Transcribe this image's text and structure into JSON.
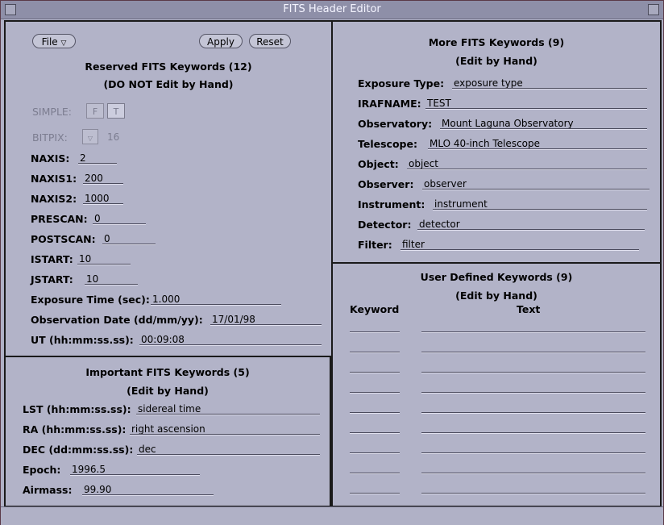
{
  "window": {
    "title": "FITS Header Editor"
  },
  "toolbar": {
    "file_label": "File",
    "apply_label": "Apply",
    "reset_label": "Reset"
  },
  "reserved": {
    "title": "Reserved FITS Keywords (12)",
    "subtitle": "(DO NOT Edit by Hand)",
    "simple_label": "SIMPLE:",
    "simple_options": [
      "F",
      "T"
    ],
    "bitpix_label": "BITPIX:",
    "bitpix_value": "16",
    "fields": [
      {
        "label": "NAXIS:",
        "value": "2"
      },
      {
        "label": "NAXIS1:",
        "value": "200"
      },
      {
        "label": "NAXIS2:",
        "value": "1000"
      },
      {
        "label": "PRESCAN:",
        "value": "0"
      },
      {
        "label": "POSTSCAN:",
        "value": "0"
      },
      {
        "label": "ISTART:",
        "value": "10"
      },
      {
        "label": "JSTART:",
        "value": "10"
      },
      {
        "label": "Exposure Time (sec):",
        "value": "1.000"
      },
      {
        "label": "Observation Date (dd/mm/yy):",
        "value": "17/01/98"
      },
      {
        "label": "UT (hh:mm:ss.ss):",
        "value": "00:09:08"
      }
    ]
  },
  "important": {
    "title": "Important FITS Keywords (5)",
    "subtitle": "(Edit by Hand)",
    "fields": [
      {
        "label": "LST (hh:mm:ss.ss):",
        "value": "sidereal time"
      },
      {
        "label": "RA (hh:mm:ss.ss):",
        "value": "right ascension"
      },
      {
        "label": "DEC (dd:mm:ss.ss):",
        "value": "dec"
      },
      {
        "label": "Epoch:",
        "value": "1996.5"
      },
      {
        "label": "Airmass:",
        "value": "99.90"
      }
    ]
  },
  "more": {
    "title": "More FITS Keywords (9)",
    "subtitle": "(Edit by Hand)",
    "fields": [
      {
        "label": "Exposure Type:",
        "value": "exposure type"
      },
      {
        "label": "IRAFNAME:",
        "value": "TEST"
      },
      {
        "label": "Observatory:",
        "value": "Mount Laguna Observatory"
      },
      {
        "label": "Telescope:",
        "value": "MLO 40-inch Telescope"
      },
      {
        "label": "Object:",
        "value": "object"
      },
      {
        "label": "Observer:",
        "value": "observer"
      },
      {
        "label": "Instrument:",
        "value": "instrument"
      },
      {
        "label": "Detector:",
        "value": "detector"
      },
      {
        "label": "Filter:",
        "value": "filter"
      }
    ]
  },
  "user": {
    "title": "User Defined Keywords (9)",
    "subtitle": "(Edit by Hand)",
    "keyword_header": "Keyword",
    "text_header": "Text"
  }
}
